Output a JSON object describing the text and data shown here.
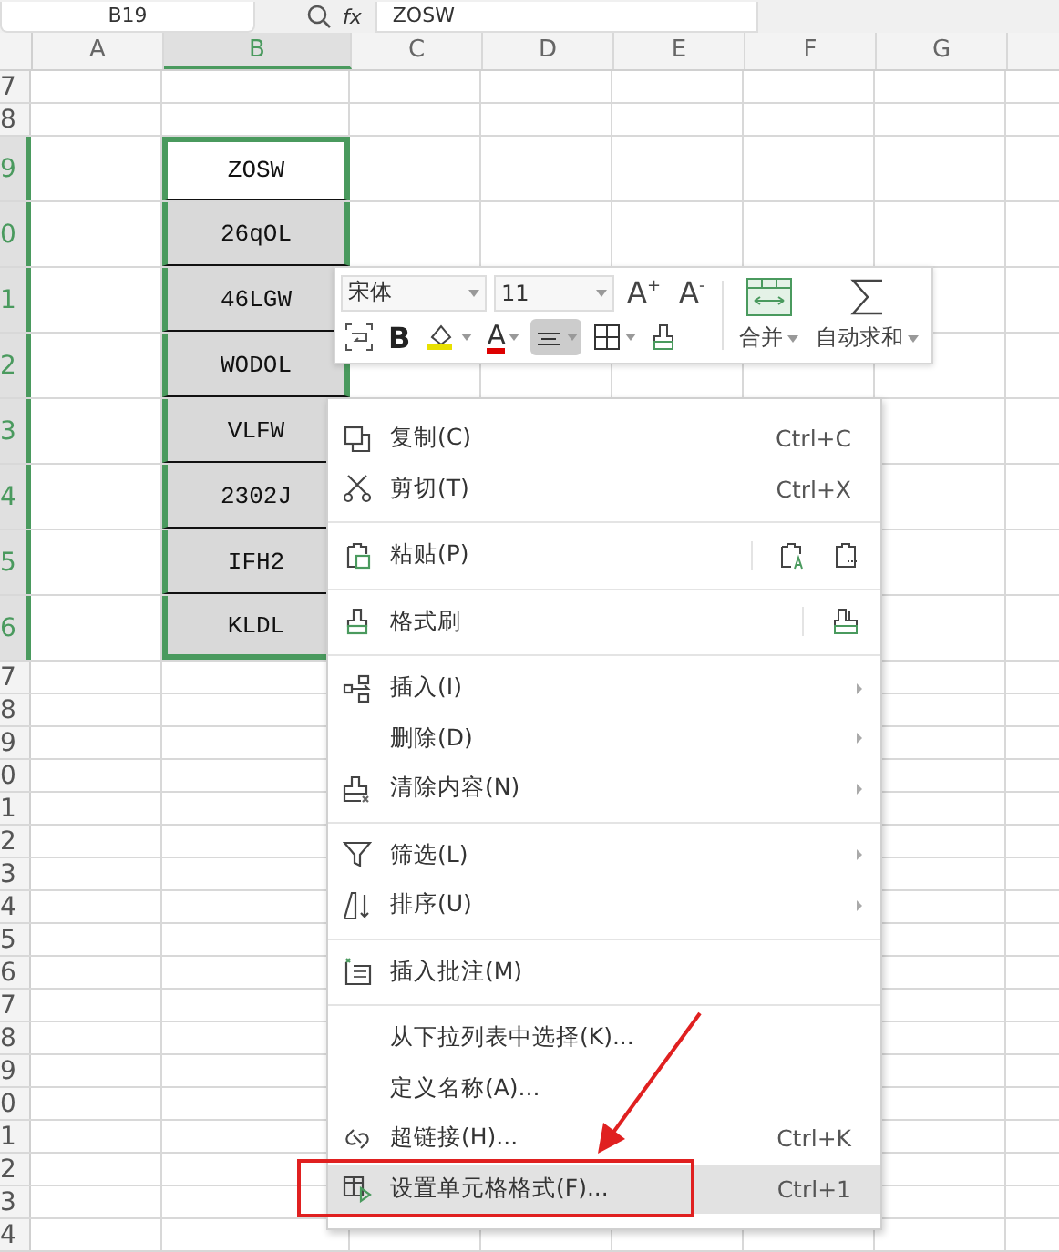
{
  "formula_bar": {
    "name_box": "B19",
    "function_label": "fx",
    "formula": "ZOSW"
  },
  "columns": [
    {
      "label": "A",
      "selected": false
    },
    {
      "label": "B",
      "selected": true
    },
    {
      "label": "C",
      "selected": false
    },
    {
      "label": "D",
      "selected": false
    },
    {
      "label": "E",
      "selected": false
    },
    {
      "label": "F",
      "selected": false
    },
    {
      "label": "G",
      "selected": false
    }
  ],
  "rows": [
    {
      "label": "7",
      "selected": false
    },
    {
      "label": "8",
      "selected": false
    },
    {
      "label": "9",
      "selected": true,
      "cell_b": {
        "value": "ZOSW",
        "active": true
      }
    },
    {
      "label": "0",
      "selected": true,
      "cell_b": {
        "value": "26qOL",
        "active": false
      }
    },
    {
      "label": "1",
      "selected": true,
      "cell_b": {
        "value": "46LGW",
        "active": false
      }
    },
    {
      "label": "2",
      "selected": true,
      "cell_b": {
        "value": "WODOL",
        "active": false
      }
    },
    {
      "label": "3",
      "selected": true,
      "cell_b": {
        "value": "VLFW",
        "active": false
      }
    },
    {
      "label": "4",
      "selected": true,
      "cell_b": {
        "value": "2302J",
        "active": false
      }
    },
    {
      "label": "5",
      "selected": true,
      "cell_b": {
        "value": "IFH2",
        "active": false
      }
    },
    {
      "label": "6",
      "selected": true,
      "cell_b": {
        "value": "KLDL",
        "active": false
      }
    },
    {
      "label": "7",
      "selected": false
    },
    {
      "label": "8",
      "selected": false
    },
    {
      "label": "9",
      "selected": false
    },
    {
      "label": "0",
      "selected": false
    },
    {
      "label": "1",
      "selected": false
    },
    {
      "label": "2",
      "selected": false
    },
    {
      "label": "3",
      "selected": false
    },
    {
      "label": "4",
      "selected": false
    },
    {
      "label": "5",
      "selected": false
    },
    {
      "label": "6",
      "selected": false
    },
    {
      "label": "7",
      "selected": false
    },
    {
      "label": "8",
      "selected": false
    },
    {
      "label": "9",
      "selected": false
    },
    {
      "label": "0",
      "selected": false
    },
    {
      "label": "1",
      "selected": false
    },
    {
      "label": "2",
      "selected": false
    },
    {
      "label": "3",
      "selected": false
    },
    {
      "label": "4",
      "selected": false
    }
  ],
  "mini_toolbar": {
    "font_name": "宋体",
    "font_size": "11",
    "top_buttons": [
      {
        "label": "A$^{+}$"
      },
      {
        "label": "A$^{-}$"
      }
    ],
    "big_buttons": [
      {
        "kind": "merge",
        "label": "合并"
      },
      {
        "kind": "autosum",
        "label": "自动求和"
      }
    ],
    "tools": [
      {
        "kind": "wrap",
        "selected": false
      },
      {
        "kind": "bold",
        "label": "B",
        "selected": false
      },
      {
        "kind": "fill",
        "selected": false
      },
      {
        "kind": "font-color",
        "label": "A",
        "selected": false
      },
      {
        "kind": "align",
        "selected": true
      },
      {
        "kind": "border",
        "selected": false
      },
      {
        "kind": "brush",
        "selected": false
      }
    ]
  },
  "context_menu": [
    [
      {
        "kind": "copy",
        "label": "复制(C)",
        "shortcut": "Ctrl+C",
        "submenu": false,
        "selected": false
      },
      {
        "kind": "cut",
        "label": "剪切(T)",
        "shortcut": "Ctrl+X",
        "submenu": false,
        "selected": false
      }
    ],
    [
      {
        "kind": "paste",
        "label": "粘贴(P)",
        "submenu": false,
        "selected": false
      }
    ],
    [
      {
        "kind": "brush",
        "label": "格式刷",
        "submenu": false,
        "selected": false
      }
    ],
    [
      {
        "kind": "insert",
        "label": "插入(I)",
        "submenu": true,
        "selected": false
      },
      {
        "kind": "plain",
        "label": "删除(D)",
        "submenu": true,
        "selected": false
      },
      {
        "kind": "clear",
        "label": "清除内容(N)",
        "submenu": true,
        "selected": false
      }
    ],
    [
      {
        "kind": "filter",
        "label": "筛选(L)",
        "submenu": true,
        "selected": false
      },
      {
        "kind": "sort",
        "label": "排序(U)",
        "submenu": true,
        "selected": false
      }
    ],
    [
      {
        "kind": "comment",
        "label": "插入批注(M)",
        "submenu": false,
        "selected": false
      }
    ],
    [
      {
        "kind": "plain",
        "label": "从下拉列表中选择(K)...",
        "submenu": false,
        "selected": false
      },
      {
        "kind": "plain",
        "label": "定义名称(A)...",
        "submenu": false,
        "selected": false
      },
      {
        "kind": "link",
        "label": "超链接(H)...",
        "shortcut": "Ctrl+K",
        "submenu": false,
        "selected": false
      },
      {
        "kind": "format",
        "label": "设置单元格格式(F)...",
        "shortcut": "Ctrl+1",
        "submenu": false,
        "selected": true
      }
    ]
  ]
}
